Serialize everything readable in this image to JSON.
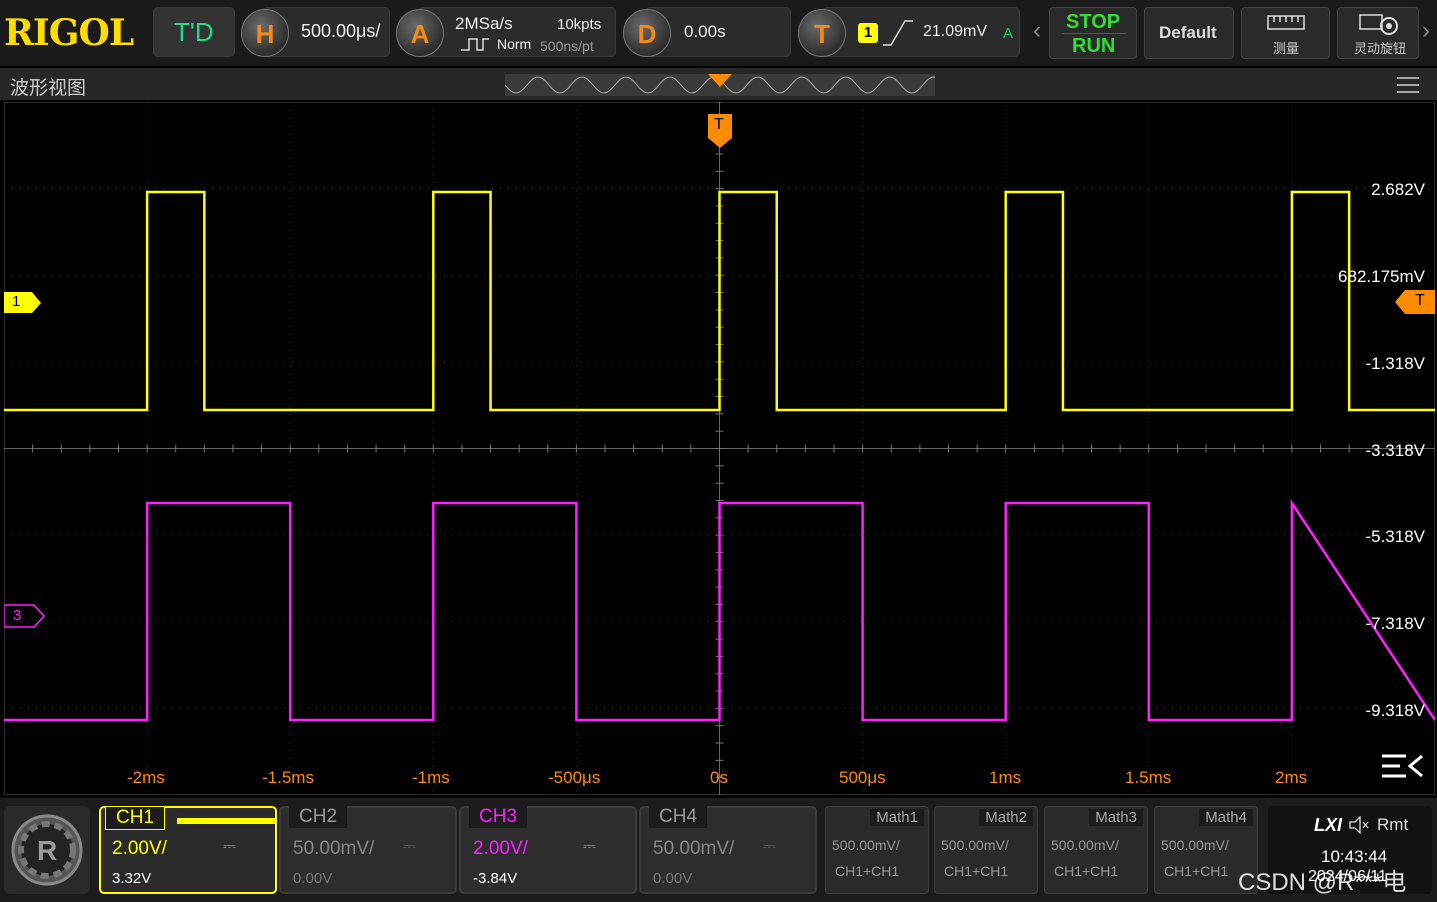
{
  "top": {
    "brand": "RIGOL",
    "td_label": "T'D",
    "h_label": "H",
    "timebase": "500.00μs/",
    "a_label": "A",
    "sample_rate": "2MSa/s",
    "mem_depth": "10kpts",
    "acq_mode": "Norm",
    "sample_interval": "500ns/pt",
    "d_label": "D",
    "delay": "0.00s",
    "t_label": "T",
    "trigger_source": "1",
    "trigger_level": "21.09mV",
    "trigger_mode": "A",
    "stop_label": "STOP",
    "run_label": "RUN",
    "default_label": "Default",
    "measure_label": "测量",
    "knob_label": "灵动旋钮"
  },
  "title": {
    "text": "波形视图"
  },
  "scope": {
    "ch1_marker": "1",
    "ch3_marker": "3",
    "trigger_marker": "T",
    "trigger_level_marker": "T",
    "y_labels": [
      "2.682V",
      "682.175mV",
      "-1.318V",
      "-3.318V",
      "-5.318V",
      "-7.318V",
      "-9.318V"
    ],
    "x_labels": [
      "-2ms",
      "-1.5ms",
      "-1ms",
      "-500μs",
      "0s",
      "500μs",
      "1ms",
      "1.5ms",
      "2ms"
    ]
  },
  "channels": [
    {
      "name": "CH1",
      "scale": "2.00V/",
      "offset": "3.32V",
      "color": "#ffff00",
      "active": true
    },
    {
      "name": "CH2",
      "scale": "50.00mV/",
      "offset": "0.00V",
      "color": "#777777",
      "active": false
    },
    {
      "name": "CH3",
      "scale": "2.00V/",
      "offset": "-3.84V",
      "color": "#ff20ff",
      "active": true
    },
    {
      "name": "CH4",
      "scale": "50.00mV/",
      "offset": "0.00V",
      "color": "#777777",
      "active": false
    }
  ],
  "maths": [
    {
      "name": "Math1",
      "scale": "500.00mV/",
      "expr": "CH1+CH1"
    },
    {
      "name": "Math2",
      "scale": "500.00mV/",
      "expr": "CH1+CH1"
    },
    {
      "name": "Math3",
      "scale": "500.00mV/",
      "expr": "CH1+CH1"
    },
    {
      "name": "Math4",
      "scale": "500.00mV/",
      "expr": "CH1+CH1"
    }
  ],
  "status": {
    "lxi": "LXI",
    "remote": "Rmt",
    "time": "10:43:44",
    "date": "2024/06/11",
    "watermark": "CSDN @R***电"
  },
  "colors": {
    "ch1": "#ffff00",
    "ch3": "#ff20ff",
    "trigger": "#ff8c00",
    "run_green": "#33dd33"
  }
}
